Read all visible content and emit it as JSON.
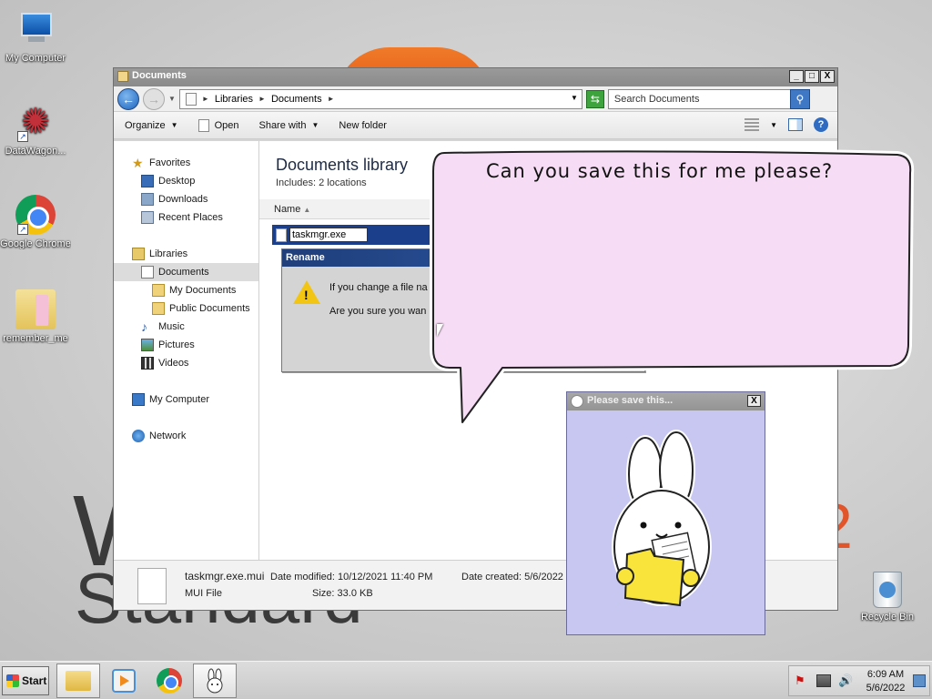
{
  "desktop": {
    "icons": [
      {
        "label": "My Computer",
        "icon": "computer-icon"
      },
      {
        "label": "DataWagon...",
        "icon": "datawagon-icon"
      },
      {
        "label": "Google Chrome",
        "icon": "chrome-icon"
      },
      {
        "label": "remember_me",
        "icon": "folder-icon"
      },
      {
        "label": "Recycle Bin",
        "icon": "recycle-bin-icon"
      }
    ],
    "wallpaper": {
      "letter": "W",
      "word": "Standard",
      "digit": "2",
      "accent": "#e2542a"
    }
  },
  "explorer": {
    "title": "Documents",
    "buttons": {
      "minimize": "_",
      "maximize": "□",
      "close": "X"
    },
    "address": {
      "crumbs": [
        "Libraries",
        "Documents"
      ]
    },
    "search": {
      "placeholder": "Search Documents"
    },
    "toolbar": {
      "organize": "Organize",
      "open": "Open",
      "share_with": "Share with",
      "new_folder": "New folder"
    },
    "nav": {
      "favorites": "Favorites",
      "desktop": "Desktop",
      "downloads": "Downloads",
      "recent_places": "Recent Places",
      "libraries": "Libraries",
      "documents": "Documents",
      "my_documents": "My Documents",
      "public_documents": "Public Documents",
      "music": "Music",
      "pictures": "Pictures",
      "videos": "Videos",
      "my_computer": "My Computer",
      "network": "Network"
    },
    "library": {
      "title": "Documents library",
      "includes_label": "Includes:",
      "locations": "2 locations"
    },
    "columns": {
      "name": "Name"
    },
    "file": {
      "rename_value": "taskmgr.exe"
    },
    "rename_dialog": {
      "title": "Rename",
      "line1": "If you change a file na",
      "line2": "Are you sure you wan"
    },
    "details": {
      "name": "taskmgr.exe.mui",
      "type": "MUI File",
      "modified_label": "Date modified:",
      "modified_value": "10/12/2021 11:40 PM",
      "size_label": "Size:",
      "size_value": "33.0 KB",
      "created_label": "Date created:",
      "created_value": "5/6/2022"
    }
  },
  "bubble": {
    "text": "Can you save this for me please?",
    "fill": "#f6dcf4"
  },
  "bunny_window": {
    "title": "Please save this...",
    "close": "X",
    "background": "#c7c7f2"
  },
  "taskbar": {
    "start": "Start",
    "clock": {
      "time": "6:09 AM",
      "date": "5/6/2022"
    }
  }
}
